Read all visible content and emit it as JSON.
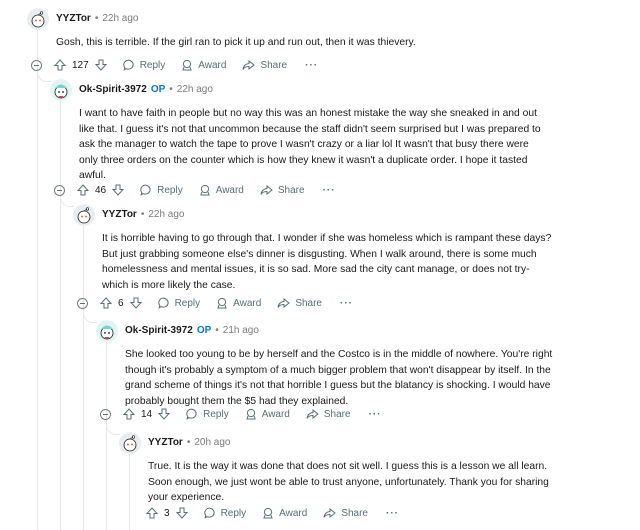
{
  "labels": {
    "reply": "Reply",
    "award": "Award",
    "share": "Share",
    "more": "···",
    "op": "OP",
    "sep": "•"
  },
  "comments": [
    {
      "author": "YYZTor",
      "time": "22h ago",
      "votes": "127",
      "body": "Gosh, this is terrible. If the girl ran to pick it up and run out, then it was thievery."
    },
    {
      "author": "Ok-Spirit-3972",
      "time": "22h ago",
      "votes": "46",
      "body": "I want to have faith in people but no way this was an honest mistake the way she sneaked in and out like that. I guess it's not that uncommon because the staff didn't seem surprised but I was prepared to ask the manager to watch the tape to prove I wasn't crazy or a liar lol It wasn't that busy there were only three orders on the counter which is how they knew it wasn't a duplicate order. I hope it tasted awful."
    },
    {
      "author": "YYZTor",
      "time": "22h ago",
      "votes": "6",
      "body": "It is horrible having to go through that. I wonder if she was homeless which is rampant these days? But just grabbing someone else's dinner is disgusting. When I walk around, there is some much homelessness and mental issues, it is so sad. More sad the city cant manage, or does not try-which is more likely the case."
    },
    {
      "author": "Ok-Spirit-3972",
      "time": "21h ago",
      "votes": "14",
      "body": "She looked too young to be by herself and the Costco is in the middle of nowhere. You're right though it's probably a symptom of a much bigger problem that won't disappear by itself. In the grand scheme of things it's not that horrible I guess but the blatancy is shocking. I would have probably bought them the $5 had they explained."
    },
    {
      "author": "YYZTor",
      "time": "20h ago",
      "votes": "3",
      "body": "True. It is the way it was done that does not sit well. I guess this is a lesson we all learn. Soon enough, we just wont be able to trust anyone, unfortunately. Thank you for sharing your experience."
    }
  ]
}
